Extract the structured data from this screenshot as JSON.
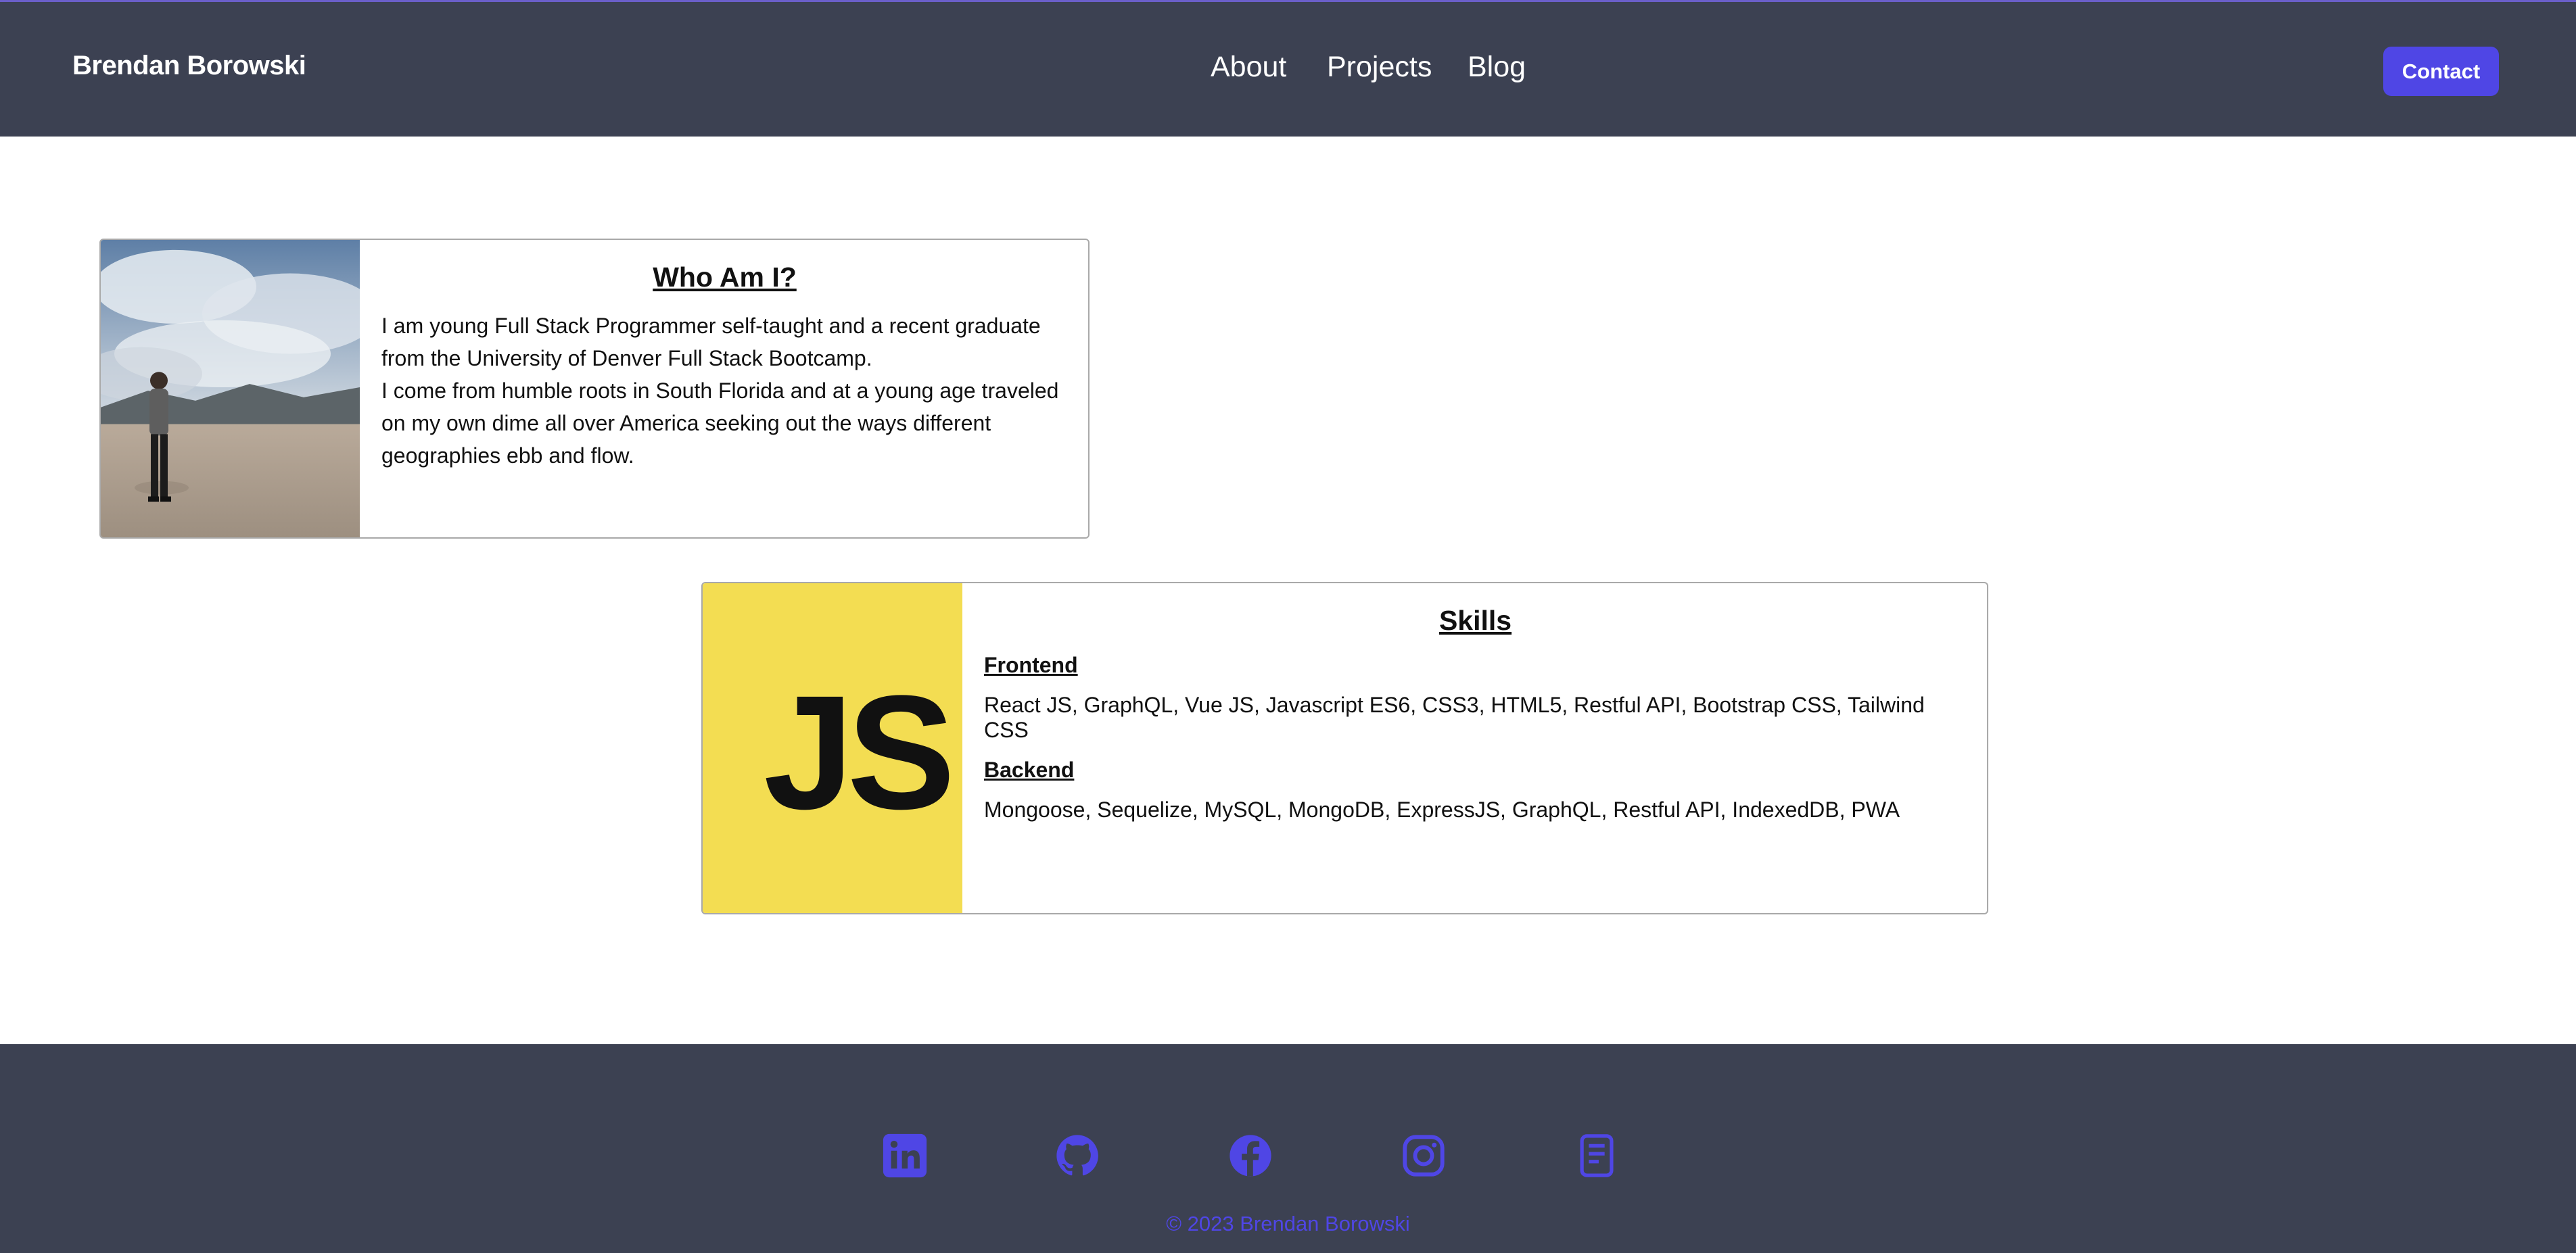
{
  "header": {
    "brand": "Brendan Borowski",
    "nav": [
      "About",
      "Projects",
      "Blog"
    ],
    "contact_label": "Contact"
  },
  "about": {
    "title": "Who Am I?",
    "paragraph1": "I am young Full Stack Programmer self-taught and a recent graduate from the University of Denver Full Stack Bootcamp.",
    "paragraph2": "I come from humble roots in South Florida and at a young age traveled on my own dime all over America seeking out the ways different geographies ebb and flow."
  },
  "skills": {
    "title": "Skills",
    "logo_text": "JS",
    "frontend_heading": "Frontend",
    "frontend_list": "React JS, GraphQL, Vue JS, Javascript ES6, CSS3, HTML5, Restful API, Bootstrap CSS, Tailwind CSS",
    "backend_heading": "Backend",
    "backend_list": "Mongoose, Sequelize, MySQL, MongoDB, ExpressJS, GraphQL, Restful API, IndexedDB, PWA"
  },
  "footer": {
    "social_icons": [
      "linkedin-icon",
      "github-icon",
      "facebook-icon",
      "instagram-icon",
      "resume-icon"
    ],
    "copyright": "© 2023 Brendan Borowski"
  },
  "colors": {
    "header_bg": "#3c4152",
    "accent": "#4f46e5",
    "js_yellow": "#f3dd52"
  }
}
